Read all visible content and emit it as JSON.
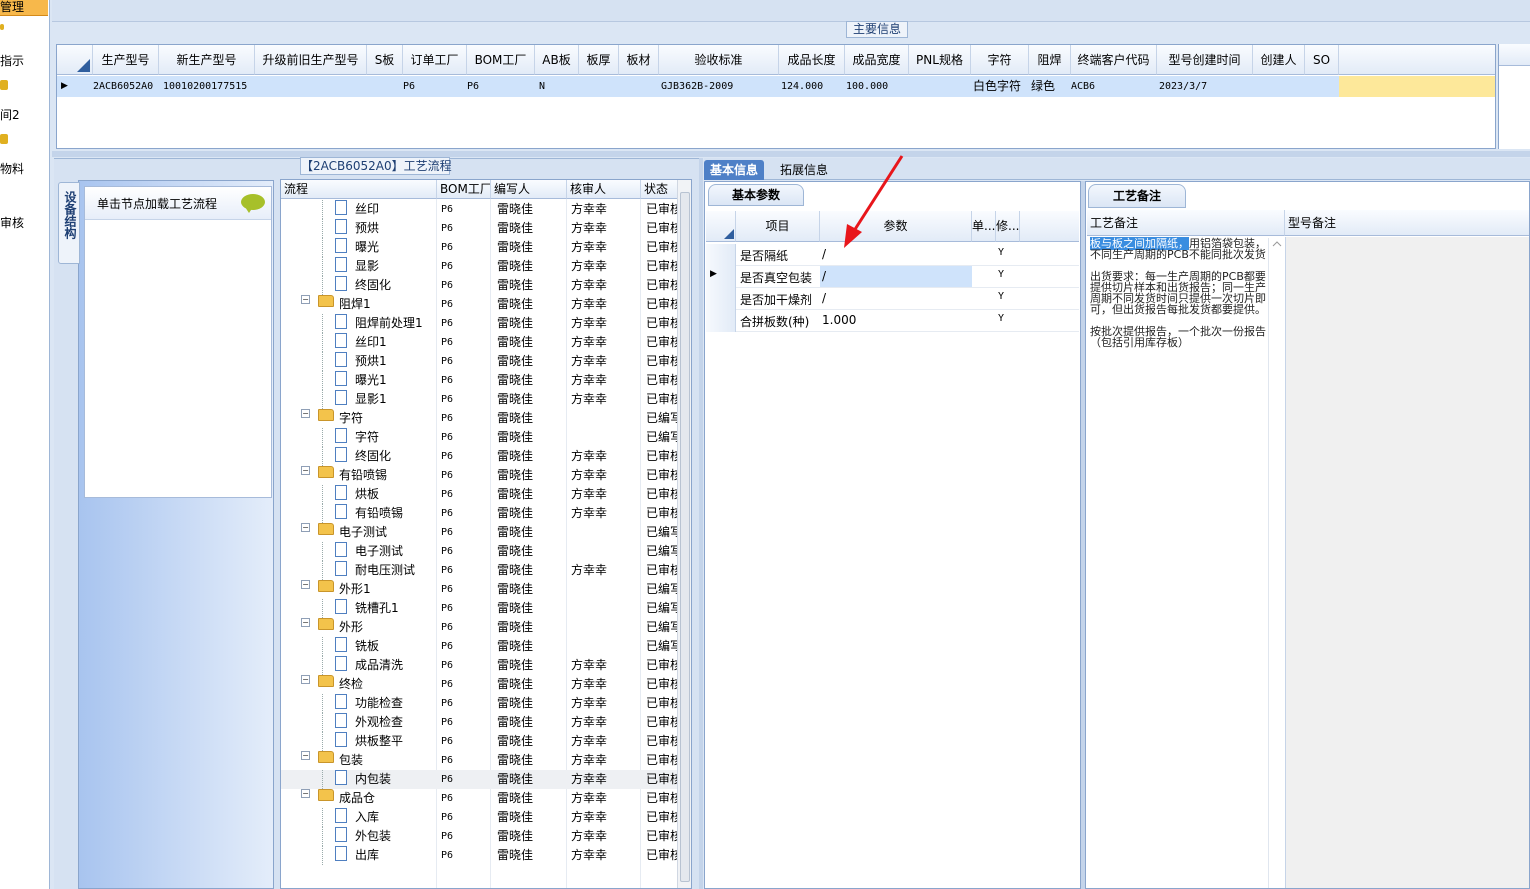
{
  "left_nav": {
    "items": [
      "管理",
      "指示",
      "间2",
      "物料",
      "审核"
    ]
  },
  "top": {
    "main_info_title": "主要信息",
    "columns": [
      "生产型号",
      "新生产型号",
      "升级前旧生产型号",
      "S板",
      "订单工厂",
      "BOM工厂",
      "AB板",
      "板厚",
      "板材",
      "验收标准",
      "成品长度",
      "成品宽度",
      "PNL规格",
      "字符",
      "阻焊",
      "终端客户代码",
      "型号创建时间",
      "创建人",
      "SO"
    ],
    "row": {
      "生产型号": "2ACB6052A0",
      "新生产型号": "10010200177515",
      "升级前旧生产型号": "",
      "S板": "",
      "订单工厂": "P6",
      "BOM工厂": "P6",
      "AB板": "N",
      "板厚": "",
      "板材": "",
      "验收标准": "GJB362B-2009",
      "成品长度": "124.000",
      "成品宽度": "100.000",
      "PNL规格": "",
      "字符": "白色字符",
      "阻焊": "绿色",
      "终端客户代码": "ACB6",
      "型号创建时间": "2023/3/7",
      "创建人": "",
      "SO": ""
    }
  },
  "process": {
    "title": "【2ACB6052A0】工艺流程",
    "side_tab": "设备结构",
    "node_hint": "单击节点加载工艺流程",
    "columns": [
      "流程",
      "BOM工厂",
      "编写人",
      "核审人",
      "状态"
    ],
    "rows": [
      {
        "level": 2,
        "type": "doc",
        "name": "丝印",
        "bom": "P6",
        "writer": "雷晓佳",
        "checker": "方幸幸",
        "status": "已审核"
      },
      {
        "level": 2,
        "type": "doc",
        "name": "预烘",
        "bom": "P6",
        "writer": "雷晓佳",
        "checker": "方幸幸",
        "status": "已审核"
      },
      {
        "level": 2,
        "type": "doc",
        "name": "曝光",
        "bom": "P6",
        "writer": "雷晓佳",
        "checker": "方幸幸",
        "status": "已审核"
      },
      {
        "level": 2,
        "type": "doc",
        "name": "显影",
        "bom": "P6",
        "writer": "雷晓佳",
        "checker": "方幸幸",
        "status": "已审核"
      },
      {
        "level": 2,
        "type": "doc",
        "name": "终固化",
        "bom": "P6",
        "writer": "雷晓佳",
        "checker": "方幸幸",
        "status": "已审核"
      },
      {
        "level": 1,
        "type": "folder",
        "name": "阻焊1",
        "bom": "P6",
        "writer": "雷晓佳",
        "checker": "方幸幸",
        "status": "已审核"
      },
      {
        "level": 2,
        "type": "doc",
        "name": "阻焊前处理1",
        "bom": "P6",
        "writer": "雷晓佳",
        "checker": "方幸幸",
        "status": "已审核"
      },
      {
        "level": 2,
        "type": "doc",
        "name": "丝印1",
        "bom": "P6",
        "writer": "雷晓佳",
        "checker": "方幸幸",
        "status": "已审核"
      },
      {
        "level": 2,
        "type": "doc",
        "name": "预烘1",
        "bom": "P6",
        "writer": "雷晓佳",
        "checker": "方幸幸",
        "status": "已审核"
      },
      {
        "level": 2,
        "type": "doc",
        "name": "曝光1",
        "bom": "P6",
        "writer": "雷晓佳",
        "checker": "方幸幸",
        "status": "已审核"
      },
      {
        "level": 2,
        "type": "doc",
        "name": "显影1",
        "bom": "P6",
        "writer": "雷晓佳",
        "checker": "方幸幸",
        "status": "已审核"
      },
      {
        "level": 1,
        "type": "folder",
        "name": "字符",
        "bom": "P6",
        "writer": "雷晓佳",
        "checker": "",
        "status": "已编写"
      },
      {
        "level": 2,
        "type": "doc",
        "name": "字符",
        "bom": "P6",
        "writer": "雷晓佳",
        "checker": "",
        "status": "已编写"
      },
      {
        "level": 2,
        "type": "doc",
        "name": "终固化",
        "bom": "P6",
        "writer": "雷晓佳",
        "checker": "方幸幸",
        "status": "已审核"
      },
      {
        "level": 1,
        "type": "folder",
        "name": "有铅喷锡",
        "bom": "P6",
        "writer": "雷晓佳",
        "checker": "方幸幸",
        "status": "已审核"
      },
      {
        "level": 2,
        "type": "doc",
        "name": "烘板",
        "bom": "P6",
        "writer": "雷晓佳",
        "checker": "方幸幸",
        "status": "已审核"
      },
      {
        "level": 2,
        "type": "doc",
        "name": "有铅喷锡",
        "bom": "P6",
        "writer": "雷晓佳",
        "checker": "方幸幸",
        "status": "已审核"
      },
      {
        "level": 1,
        "type": "folder",
        "name": "电子测试",
        "bom": "P6",
        "writer": "雷晓佳",
        "checker": "",
        "status": "已编写"
      },
      {
        "level": 2,
        "type": "doc",
        "name": "电子测试",
        "bom": "P6",
        "writer": "雷晓佳",
        "checker": "",
        "status": "已编写"
      },
      {
        "level": 2,
        "type": "doc",
        "name": "耐电压测试",
        "bom": "P6",
        "writer": "雷晓佳",
        "checker": "方幸幸",
        "status": "已审核"
      },
      {
        "level": 1,
        "type": "folder",
        "name": "外形1",
        "bom": "P6",
        "writer": "雷晓佳",
        "checker": "",
        "status": "已编写"
      },
      {
        "level": 2,
        "type": "doc",
        "name": "铣槽孔1",
        "bom": "P6",
        "writer": "雷晓佳",
        "checker": "",
        "status": "已编写"
      },
      {
        "level": 1,
        "type": "folder",
        "name": "外形",
        "bom": "P6",
        "writer": "雷晓佳",
        "checker": "",
        "status": "已编写"
      },
      {
        "level": 2,
        "type": "doc",
        "name": "铣板",
        "bom": "P6",
        "writer": "雷晓佳",
        "checker": "",
        "status": "已编写"
      },
      {
        "level": 2,
        "type": "doc",
        "name": "成品清洗",
        "bom": "P6",
        "writer": "雷晓佳",
        "checker": "方幸幸",
        "status": "已审核"
      },
      {
        "level": 1,
        "type": "folder",
        "name": "终检",
        "bom": "P6",
        "writer": "雷晓佳",
        "checker": "方幸幸",
        "status": "已审核"
      },
      {
        "level": 2,
        "type": "doc",
        "name": "功能检查",
        "bom": "P6",
        "writer": "雷晓佳",
        "checker": "方幸幸",
        "status": "已审核"
      },
      {
        "level": 2,
        "type": "doc",
        "name": "外观检查",
        "bom": "P6",
        "writer": "雷晓佳",
        "checker": "方幸幸",
        "status": "已审核"
      },
      {
        "level": 2,
        "type": "doc",
        "name": "烘板整平",
        "bom": "P6",
        "writer": "雷晓佳",
        "checker": "方幸幸",
        "status": "已审核"
      },
      {
        "level": 1,
        "type": "folder",
        "name": "包装",
        "bom": "P6",
        "writer": "雷晓佳",
        "checker": "方幸幸",
        "status": "已审核"
      },
      {
        "level": 2,
        "type": "doc",
        "name": "内包装",
        "bom": "P6",
        "writer": "雷晓佳",
        "checker": "方幸幸",
        "status": "已审核",
        "selected": true
      },
      {
        "level": 1,
        "type": "folder",
        "name": "成品仓",
        "bom": "P6",
        "writer": "雷晓佳",
        "checker": "方幸幸",
        "status": "已审核"
      },
      {
        "level": 2,
        "type": "doc",
        "name": "入库",
        "bom": "P6",
        "writer": "雷晓佳",
        "checker": "方幸幸",
        "status": "已审核"
      },
      {
        "level": 2,
        "type": "doc",
        "name": "外包装",
        "bom": "P6",
        "writer": "雷晓佳",
        "checker": "方幸幸",
        "status": "已审核"
      },
      {
        "level": 2,
        "type": "doc",
        "name": "出库",
        "bom": "P6",
        "writer": "雷晓佳",
        "checker": "方幸幸",
        "status": "已审核"
      }
    ]
  },
  "middle": {
    "tabs": [
      "基本信息",
      "拓展信息"
    ],
    "sub_tab": "基本参数",
    "columns": [
      "项目",
      "参数",
      "单...",
      "修..."
    ],
    "params": [
      {
        "item": "是否隔纸",
        "value": "/",
        "mod": "Y"
      },
      {
        "item": "是否真空包装",
        "value": "/",
        "mod": "Y",
        "current": true
      },
      {
        "item": "是否加干燥剂",
        "value": "/",
        "mod": "Y"
      },
      {
        "item": "合拼板数(种)",
        "value": "1.000",
        "mod": "Y"
      }
    ]
  },
  "remarks": {
    "tab": "工艺备注",
    "col1": "工艺备注",
    "col2": "型号备注",
    "highlight": "板与板之间加隔纸，",
    "text": "用铝箔袋包装，不同生产周期的PCB不能同批次发货\n\n出货要求：每一生产周期的PCB都要提供切片样本和出货报告；同一生产周期不同发货时间只提供一次切片即可，但出货报告每批发货都要提供。\n\n按批次提供报告，一个批次一份报告（包括引用库存板）"
  },
  "colors": {
    "accent": "#4e80c7",
    "selection": "#cfe3fb",
    "arrow": "#e8161b"
  }
}
